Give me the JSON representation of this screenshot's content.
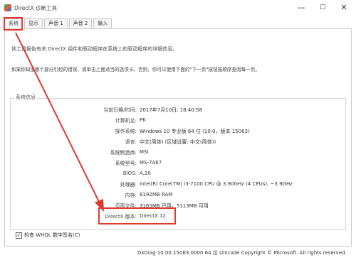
{
  "window": {
    "title": "DirectX 诊断工具",
    "controls": {
      "minimize": "—",
      "maximize": "☐",
      "close": "✕"
    }
  },
  "tabs": [
    {
      "label": "系统",
      "active": true
    },
    {
      "label": "显示",
      "active": false
    },
    {
      "label": "声音 1",
      "active": false
    },
    {
      "label": "声音 2",
      "active": false
    },
    {
      "label": "输入",
      "active": false
    }
  ],
  "intro": {
    "line1": "该工具报告有关 DirectX 组件和驱动程序在系统上的驱动程序的详细信息。",
    "line2": "如果你知道哪个部分引起的错误，请单击上面适当的选项卡。否则，你可以使用下面的\"下一页\"按钮按顺序查阅每一页。"
  },
  "system_info": {
    "group_title": "系统信息",
    "rows": [
      {
        "key": "当前日期/时间:",
        "value": "2017年7月10日, 18:40:58"
      },
      {
        "key": "计算机名:",
        "value": "PK"
      },
      {
        "key": "操作系统:",
        "value": "Windows 10 专业版 64 位 (10.0，版本 15063)"
      },
      {
        "key": "语言:",
        "value": "中文(简体) (区域设置: 中文(简体))"
      },
      {
        "key": "系统制造商:",
        "value": "MSI"
      },
      {
        "key": "系统型号:",
        "value": "MS-7A67"
      },
      {
        "key": "BIOS:",
        "value": "A.20"
      },
      {
        "key": "处理器:",
        "value": "Intel(R) Core(TM) i3-7100 CPU @ 3.90GHz (4 CPUs), ~3.9GHz"
      },
      {
        "key": "内存:",
        "value": "8192MB RAM"
      },
      {
        "key": "页面文件:",
        "value": "3165MB 已用，5113MB 可用"
      },
      {
        "key": "DirectX 版本:",
        "value": "DirectX 12"
      }
    ]
  },
  "whql": {
    "label": "检查 WHQL 数字签名(C)",
    "checked": true,
    "mark": "✓"
  },
  "footer": "DxDiag 10.00.15063.0000 64 位 Unicode  Copyright © Microsoft. All rights reserved.",
  "colors": {
    "highlight": "#e03a2e"
  }
}
